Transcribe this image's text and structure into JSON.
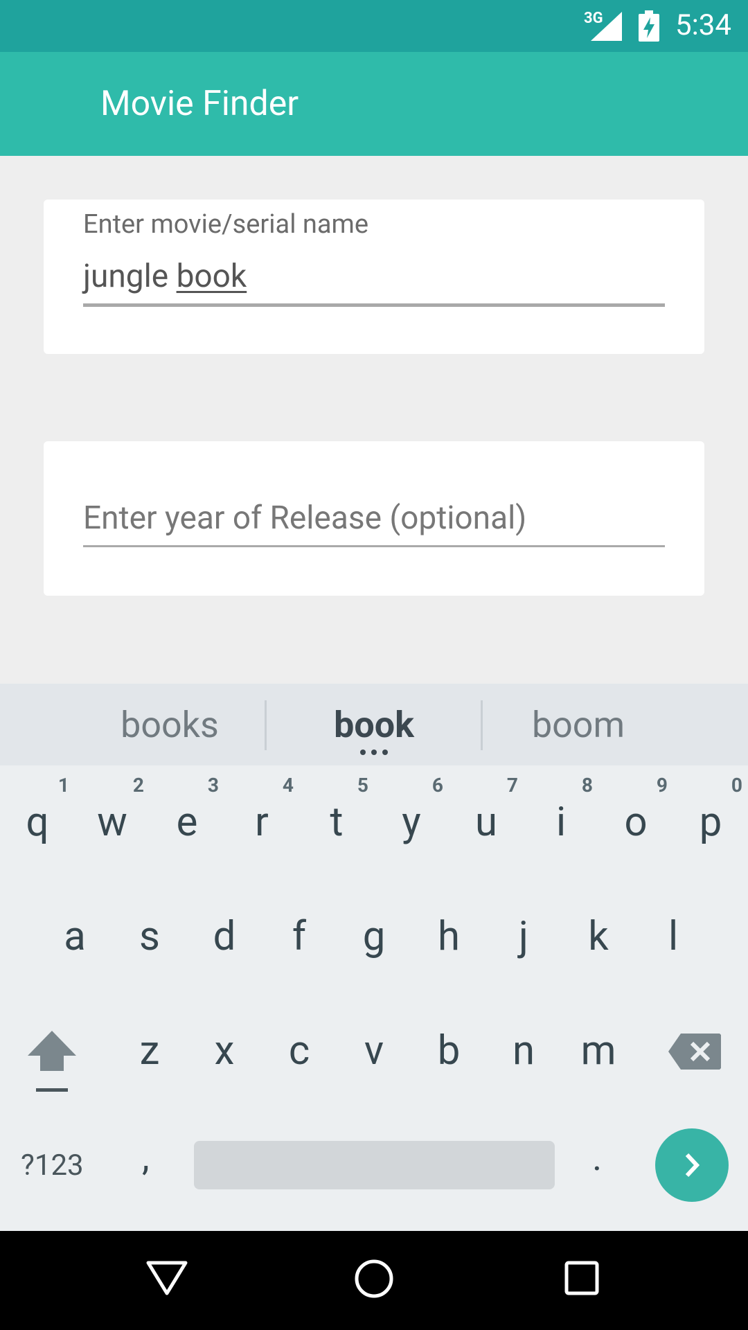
{
  "status_bar": {
    "network": "3G",
    "time": "5:34"
  },
  "app_bar": {
    "title": "Movie Finder"
  },
  "form": {
    "name_field": {
      "label": "Enter movie/serial name",
      "value_prefix": "jungle ",
      "value_composing": "book"
    },
    "year_field": {
      "placeholder": "Enter year of Release (optional)"
    }
  },
  "keyboard": {
    "suggestions": [
      "books",
      "book",
      "boom"
    ],
    "row1": [
      {
        "char": "q",
        "num": "1"
      },
      {
        "char": "w",
        "num": "2"
      },
      {
        "char": "e",
        "num": "3"
      },
      {
        "char": "r",
        "num": "4"
      },
      {
        "char": "t",
        "num": "5"
      },
      {
        "char": "y",
        "num": "6"
      },
      {
        "char": "u",
        "num": "7"
      },
      {
        "char": "i",
        "num": "8"
      },
      {
        "char": "o",
        "num": "9"
      },
      {
        "char": "p",
        "num": "0"
      }
    ],
    "row2": [
      "a",
      "s",
      "d",
      "f",
      "g",
      "h",
      "j",
      "k",
      "l"
    ],
    "row3": [
      "z",
      "x",
      "c",
      "v",
      "b",
      "n",
      "m"
    ],
    "symbols_label": "?123",
    "comma": ",",
    "period": "."
  }
}
